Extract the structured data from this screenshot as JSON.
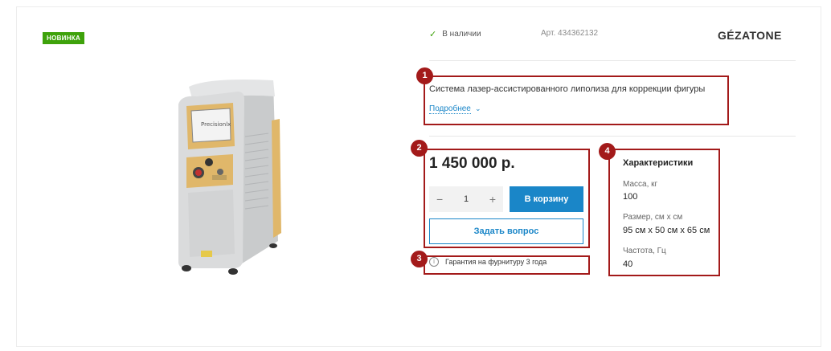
{
  "badge": "НОВИНКА",
  "stock": {
    "icon": "check-icon",
    "label": "В наличии"
  },
  "sku": "Арт. 434362132",
  "brand": "GÉZATONE",
  "product": {
    "description": "Система лазер-ассистированного липолиза для коррекции фигуры",
    "more_link": "Подробнее",
    "price": "1 450 000 р.",
    "quantity": "1",
    "cart_button": "В корзину",
    "ask_button": "Задать вопрос",
    "warranty": "Гарантия на фурнитуру 3 года",
    "device_screen_text": "Precisionlx"
  },
  "specs": {
    "title": "Характеристики",
    "items": [
      {
        "label": "Масса, кг",
        "value": "100"
      },
      {
        "label": "Размер, см х см",
        "value": "95 см х 50 см х 65 см"
      },
      {
        "label": "Частота, Гц",
        "value": "40"
      }
    ]
  },
  "markers": [
    "1",
    "2",
    "3",
    "4"
  ],
  "colors": {
    "accent": "#1a86c8",
    "badge": "#3ea20b",
    "annotation": "#a31a1a"
  }
}
